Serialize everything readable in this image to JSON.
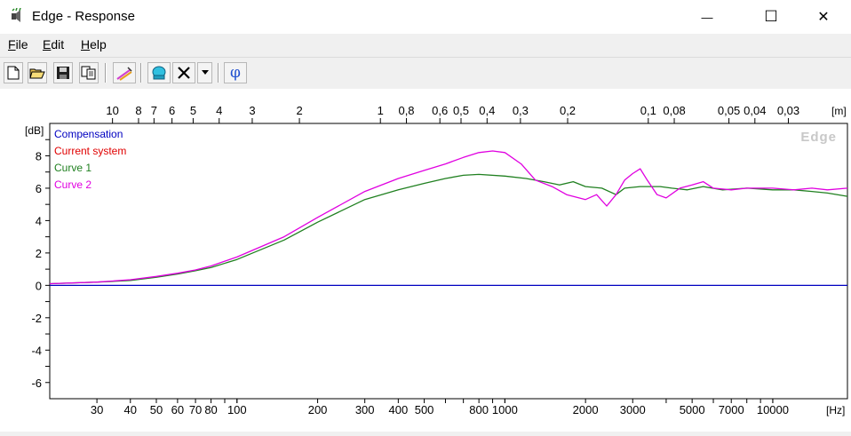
{
  "window": {
    "title": "Edge - Response",
    "minimize_glyph": "—",
    "maximize_glyph": "☐",
    "close_glyph": "✕"
  },
  "menu": {
    "file": {
      "key": "F",
      "rest": "ile"
    },
    "edit": {
      "key": "E",
      "rest": "dit"
    },
    "help": {
      "key": "H",
      "rest": "elp"
    }
  },
  "toolbar": {
    "icons": [
      "new-file-icon",
      "open-folder-icon",
      "save-disk-icon",
      "copy-icon",
      "pencil-icon",
      "speaker-icon",
      "delete-x-icon",
      "dropdown-arrow-icon",
      "phi-icon"
    ],
    "phi_glyph": "φ"
  },
  "chart_data": {
    "type": "line",
    "watermark": "Edge",
    "ylabel": "[dB]",
    "xlabel": "[Hz]",
    "top_axis_label": "[m]",
    "xscale": "log",
    "xlim": [
      20,
      19000
    ],
    "ylim": [
      -7,
      10
    ],
    "grid": true,
    "legend_position": "top-left",
    "y_ticks": [
      8,
      6,
      4,
      2,
      0,
      -2,
      -4,
      -6
    ],
    "x_ticks": [
      30,
      40,
      50,
      60,
      70,
      80,
      100,
      200,
      300,
      400,
      500,
      800,
      1000,
      2000,
      3000,
      5000,
      7000,
      10000
    ],
    "x_tick_labels": [
      "30",
      "40",
      "50",
      "60",
      "70",
      "80",
      "100",
      "200",
      "300",
      "400",
      "500",
      "800",
      "1000",
      "2000",
      "3000",
      "5000",
      "7000",
      "10000"
    ],
    "top_ticks": [
      {
        "label": "10",
        "hz": 34.3
      },
      {
        "label": "8",
        "hz": 42.9
      },
      {
        "label": "7",
        "hz": 49
      },
      {
        "label": "6",
        "hz": 57.2
      },
      {
        "label": "5",
        "hz": 68.6
      },
      {
        "label": "4",
        "hz": 85.8
      },
      {
        "label": "3",
        "hz": 114
      },
      {
        "label": "2",
        "hz": 171
      },
      {
        "label": "1",
        "hz": 343
      },
      {
        "label": "0,8",
        "hz": 429
      },
      {
        "label": "0,6",
        "hz": 572
      },
      {
        "label": "0,5",
        "hz": 686
      },
      {
        "label": "0,4",
        "hz": 858
      },
      {
        "label": "0,3",
        "hz": 1143
      },
      {
        "label": "0,2",
        "hz": 1715
      },
      {
        "label": "0,1",
        "hz": 3430
      },
      {
        "label": "0,08",
        "hz": 4288
      },
      {
        "label": "0,05",
        "hz": 6860
      },
      {
        "label": "0,04",
        "hz": 8575
      },
      {
        "label": "0,03",
        "hz": 11433
      }
    ],
    "series": [
      {
        "name": "Compensation",
        "color": "#0000c0",
        "points": [
          [
            20,
            0
          ],
          [
            19000,
            0
          ]
        ]
      },
      {
        "name": "Current system",
        "color": "#e00000",
        "points": []
      },
      {
        "name": "Curve 1",
        "color": "#208020",
        "points": [
          [
            20,
            0.1
          ],
          [
            30,
            0.2
          ],
          [
            40,
            0.3
          ],
          [
            50,
            0.5
          ],
          [
            60,
            0.7
          ],
          [
            70,
            0.9
          ],
          [
            80,
            1.1
          ],
          [
            100,
            1.6
          ],
          [
            150,
            2.8
          ],
          [
            200,
            3.9
          ],
          [
            300,
            5.3
          ],
          [
            400,
            5.9
          ],
          [
            500,
            6.3
          ],
          [
            600,
            6.6
          ],
          [
            700,
            6.8
          ],
          [
            800,
            6.85
          ],
          [
            1000,
            6.75
          ],
          [
            1200,
            6.6
          ],
          [
            1400,
            6.4
          ],
          [
            1600,
            6.2
          ],
          [
            1800,
            6.4
          ],
          [
            2000,
            6.1
          ],
          [
            2300,
            6.0
          ],
          [
            2600,
            5.6
          ],
          [
            2800,
            6.0
          ],
          [
            3200,
            6.1
          ],
          [
            3800,
            6.1
          ],
          [
            4200,
            6.0
          ],
          [
            4800,
            5.9
          ],
          [
            5500,
            6.1
          ],
          [
            6500,
            5.9
          ],
          [
            8000,
            6.0
          ],
          [
            10000,
            5.9
          ],
          [
            12000,
            5.9
          ],
          [
            14000,
            5.8
          ],
          [
            16000,
            5.7
          ],
          [
            19000,
            5.5
          ]
        ]
      },
      {
        "name": "Curve 2",
        "color": "#e000e0",
        "points": [
          [
            20,
            0.1
          ],
          [
            30,
            0.2
          ],
          [
            40,
            0.35
          ],
          [
            50,
            0.55
          ],
          [
            60,
            0.75
          ],
          [
            70,
            0.95
          ],
          [
            80,
            1.2
          ],
          [
            100,
            1.75
          ],
          [
            150,
            3.0
          ],
          [
            200,
            4.2
          ],
          [
            300,
            5.8
          ],
          [
            400,
            6.6
          ],
          [
            500,
            7.1
          ],
          [
            600,
            7.5
          ],
          [
            700,
            7.9
          ],
          [
            800,
            8.2
          ],
          [
            900,
            8.3
          ],
          [
            1000,
            8.2
          ],
          [
            1150,
            7.5
          ],
          [
            1300,
            6.5
          ],
          [
            1500,
            6.1
          ],
          [
            1700,
            5.6
          ],
          [
            2000,
            5.3
          ],
          [
            2200,
            5.6
          ],
          [
            2400,
            4.9
          ],
          [
            2600,
            5.6
          ],
          [
            2800,
            6.5
          ],
          [
            3000,
            6.9
          ],
          [
            3200,
            7.2
          ],
          [
            3400,
            6.5
          ],
          [
            3700,
            5.6
          ],
          [
            4000,
            5.4
          ],
          [
            4500,
            6.0
          ],
          [
            5000,
            6.2
          ],
          [
            5500,
            6.4
          ],
          [
            6000,
            6.0
          ],
          [
            7000,
            5.9
          ],
          [
            8000,
            6.0
          ],
          [
            10000,
            6.0
          ],
          [
            12000,
            5.9
          ],
          [
            14000,
            6.0
          ],
          [
            16000,
            5.9
          ],
          [
            19000,
            6.0
          ]
        ]
      }
    ]
  }
}
